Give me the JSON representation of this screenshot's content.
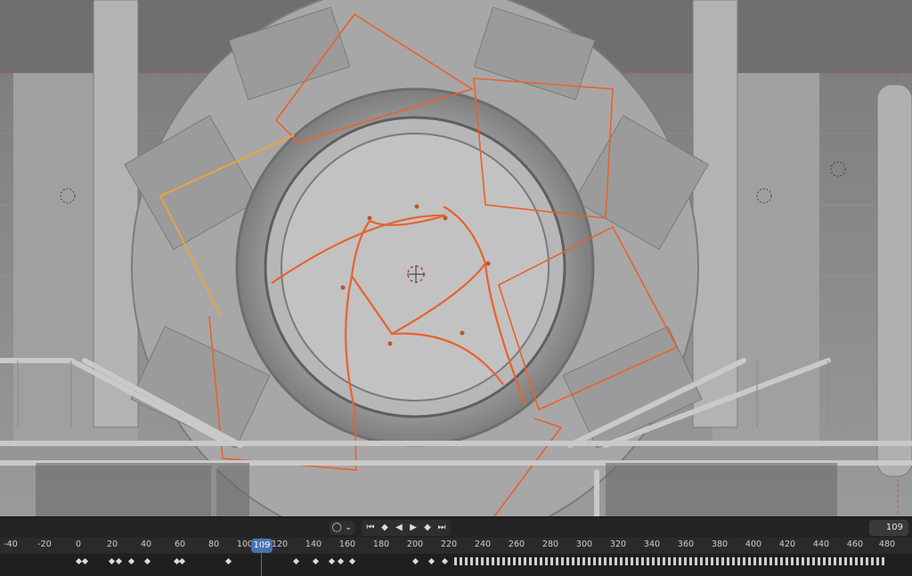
{
  "viewport": {
    "description": "3D viewport showing a grey machinery model with an iris/aperture door and orange selected curves",
    "accent_selection_color": "#e8622e",
    "active_selection_color": "#f2a33a"
  },
  "playbar": {
    "keying_icon": "record-circle-icon",
    "controls": [
      "jump-start-icon",
      "prev-keyframe-icon",
      "play-reverse-icon",
      "play-icon",
      "next-keyframe-icon",
      "jump-end-icon"
    ],
    "current_frame_value": "109"
  },
  "timeline": {
    "ticks": [
      "-40",
      "-20",
      "0",
      "20",
      "40",
      "60",
      "80",
      "100",
      "120",
      "140",
      "160",
      "180",
      "200",
      "220",
      "240",
      "260",
      "280",
      "300",
      "320",
      "340",
      "360",
      "380",
      "400",
      "420",
      "440",
      "460",
      "480"
    ],
    "current_frame": "109",
    "playhead_color": "#4772b3"
  }
}
